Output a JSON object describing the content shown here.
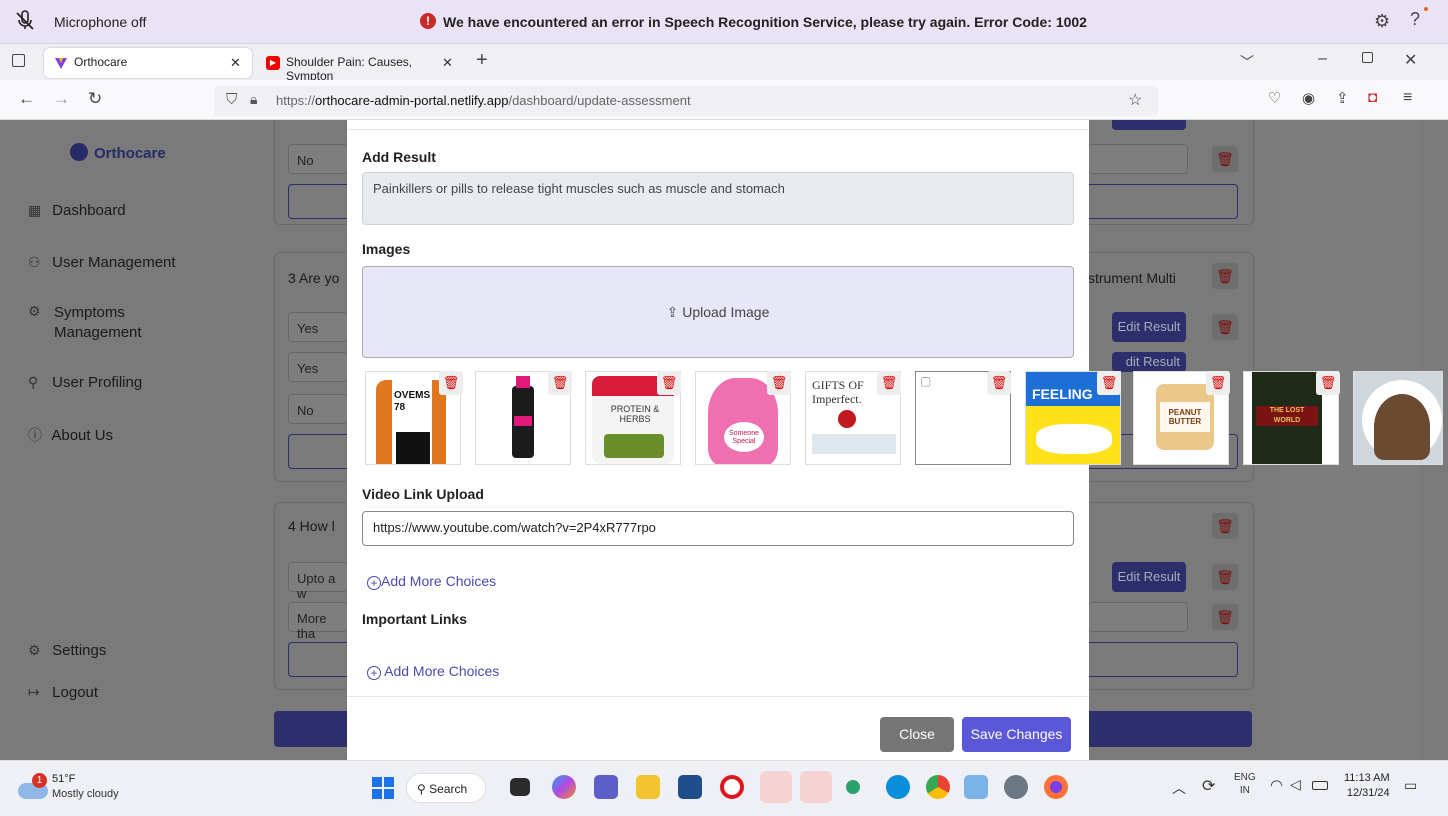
{
  "error_bar": {
    "mic_label": "Microphone off",
    "error_message": "We have encountered an error in Speech Recognition Service, please try again. Error Code: 1002",
    "help_label": "?"
  },
  "tabs": [
    {
      "title": "Orthocare",
      "active": true
    },
    {
      "title": "Shoulder Pain: Causes, Sympton"
    }
  ],
  "address_bar": {
    "url_prefix": "https://",
    "url_host": "orthocare-admin-portal.netlify.app",
    "url_path": "/dashboard/update-assessment"
  },
  "sidebar": {
    "brand": "Orthocare",
    "items": [
      {
        "label": "Dashboard",
        "icon": "grid-icon"
      },
      {
        "label": "User Management",
        "icon": "users-icon"
      },
      {
        "label": "Symptoms Management",
        "icon": "gear-outline-icon"
      },
      {
        "label": "User Profiling",
        "icon": "user-profile-icon"
      },
      {
        "label": "About Us",
        "icon": "help-circle-icon"
      }
    ],
    "settings_label": "Settings",
    "logout_label": "Logout"
  },
  "background": {
    "q2_option_no": "No",
    "q3_title": "3 Are yo",
    "q3_type": "strument Multi",
    "q3_options": [
      "Yes",
      "Yes",
      "No"
    ],
    "q4_title": "4 How l",
    "q4_options": [
      "Upto a w",
      "More tha"
    ],
    "edit_result_label": "Edit Result",
    "edit_result_partial": "dit Result"
  },
  "modal": {
    "add_result_label": "Add Result",
    "result_text": "Painkillers or pills to release tight muscles such as muscle and stomach",
    "images_label": "Images",
    "upload_label": "Upload Image",
    "thumbnails": [
      {
        "name": "orange-jacket",
        "caption": "OVEMS 78"
      },
      {
        "name": "shampoo-bottle",
        "caption": ""
      },
      {
        "name": "protein-herbs",
        "caption": "PROTEIN & HERBS"
      },
      {
        "name": "pink-teddy",
        "caption": "Someone Special"
      },
      {
        "name": "gifts-of-imperfection",
        "caption": "GIFTS OF Imperfect."
      },
      {
        "name": "broken-image",
        "caption": ""
      },
      {
        "name": "no-hard-feelings",
        "caption": "FEELING"
      },
      {
        "name": "peanut-butter",
        "caption": "PEANUT BUTTER"
      },
      {
        "name": "lost-world",
        "caption": "THE LOST WORLD"
      },
      {
        "name": "profile-photo",
        "caption": ""
      }
    ],
    "video_label": "Video Link Upload",
    "video_value": "https://www.youtube.com/watch?v=2P4xR777rpo",
    "add_more_1": "Add More Choices",
    "important_links_label": "Important Links",
    "add_more_2": "Add More Choices",
    "close_label": "Close",
    "save_label": "Save Changes"
  },
  "taskbar": {
    "weather_temp": "51°F",
    "weather_desc": "Mostly cloudy",
    "weather_badge": "1",
    "search_label": "Search",
    "lang_line1": "ENG",
    "lang_line2": "IN",
    "time": "11:13 AM",
    "date": "12/31/24"
  }
}
